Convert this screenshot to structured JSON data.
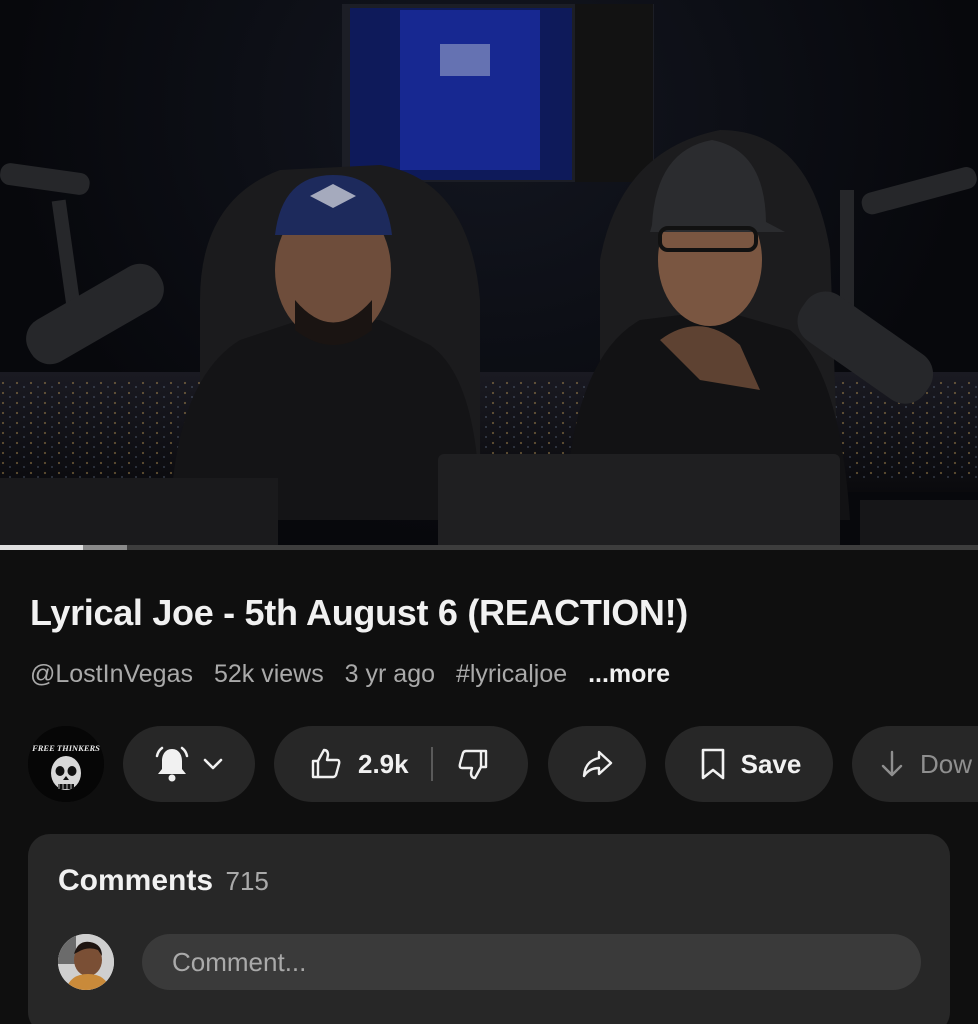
{
  "video": {
    "progress_played": 0.085,
    "progress_buffered": 0.13
  },
  "info": {
    "title": "Lyrical Joe - 5th August 6 (REACTION!)",
    "channel_handle": "@LostInVegas",
    "views": "52k views",
    "age": "3 yr ago",
    "hashtag": "#lyricaljoe",
    "more_label": "...more"
  },
  "actions": {
    "channel_avatar_text": "FREE THINKERS",
    "like_count": "2.9k",
    "save_label": "Save",
    "download_label": "Dow"
  },
  "icons": {
    "bell": "bell-icon",
    "chevron": "chevron-down-icon",
    "like": "thumbs-up-icon",
    "dislike": "thumbs-down-icon",
    "share": "share-icon",
    "save": "bookmark-icon",
    "download": "download-icon"
  },
  "comments": {
    "label": "Comments",
    "count": "715",
    "placeholder": "Comment..."
  }
}
